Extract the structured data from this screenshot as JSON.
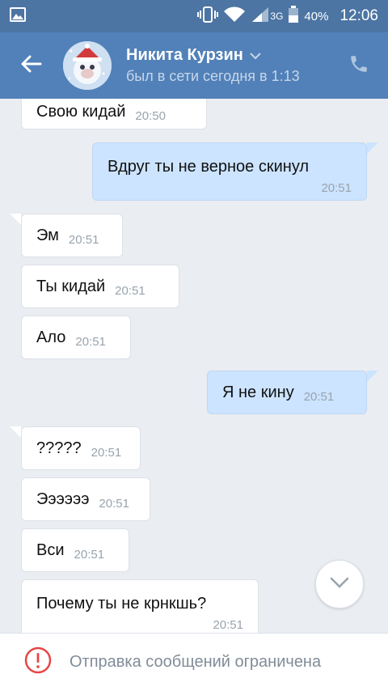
{
  "status_bar": {
    "network": "3G",
    "battery": "40%",
    "time": "12:06"
  },
  "header": {
    "name": "Никита Курзин",
    "status": "был в сети сегодня в 1:13"
  },
  "messages": [
    {
      "dir": "in",
      "text": "Свою кидай",
      "time": "20:50"
    },
    {
      "dir": "out",
      "text": "Вдруг ты не верное скинул",
      "time": "20:51"
    },
    {
      "dir": "in",
      "text": "Эм",
      "time": "20:51"
    },
    {
      "dir": "in",
      "text": "Ты кидай",
      "time": "20:51"
    },
    {
      "dir": "in",
      "text": "Ало",
      "time": "20:51"
    },
    {
      "dir": "out",
      "text": "Я не кину",
      "time": "20:51"
    },
    {
      "dir": "in",
      "text": "?????",
      "time": "20:51"
    },
    {
      "dir": "in",
      "text": "Ээээээ",
      "time": "20:51"
    },
    {
      "dir": "in",
      "text": "Вси",
      "time": "20:51"
    },
    {
      "dir": "in",
      "text": "Почему ты не крнкшь?",
      "time": "20:51"
    }
  ],
  "bottom": {
    "notice": "Отправка сообщений ограничена"
  },
  "colors": {
    "header": "#5181b8",
    "status_bar": "#4c75a3",
    "incoming_bubble": "#ffffff",
    "outgoing_bubble": "#cce4ff",
    "warning": "#e64646"
  }
}
